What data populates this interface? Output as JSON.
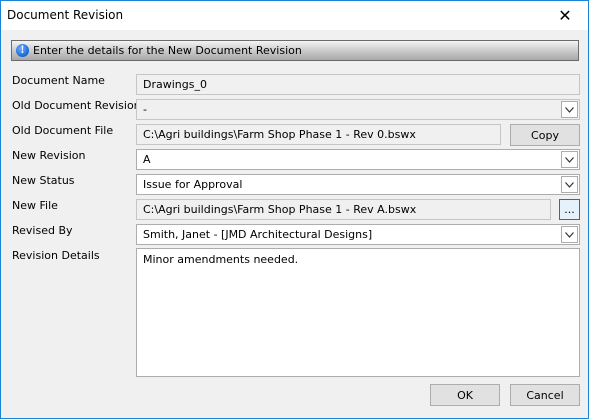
{
  "window": {
    "title": "Document Revision",
    "close_glyph": "✕"
  },
  "banner": {
    "icon": "info-icon",
    "icon_glyph": "!",
    "text": "Enter the details for the New Document Revision"
  },
  "fields": {
    "document_name": {
      "label": "Document Name",
      "value": "Drawings_0"
    },
    "old_revision": {
      "label": "Old Document Revision",
      "value": "-"
    },
    "old_file": {
      "label": "Old Document File",
      "value": "C:\\Agri buildings\\Farm Shop Phase 1 - Rev 0.bswx",
      "button": "Copy"
    },
    "new_revision": {
      "label": "New Revision",
      "value": "A"
    },
    "new_status": {
      "label": "New Status",
      "value": "Issue for Approval"
    },
    "new_file": {
      "label": "New File",
      "value": "C:\\Agri buildings\\Farm Shop Phase 1 - Rev A.bswx",
      "button": "..."
    },
    "revised_by": {
      "label": "Revised By",
      "value": "Smith, Janet - [JMD Architectural Designs]"
    },
    "revision_details": {
      "label": "Revision Details",
      "value": "Minor amendments needed."
    }
  },
  "buttons": {
    "ok": "OK",
    "cancel": "Cancel"
  }
}
